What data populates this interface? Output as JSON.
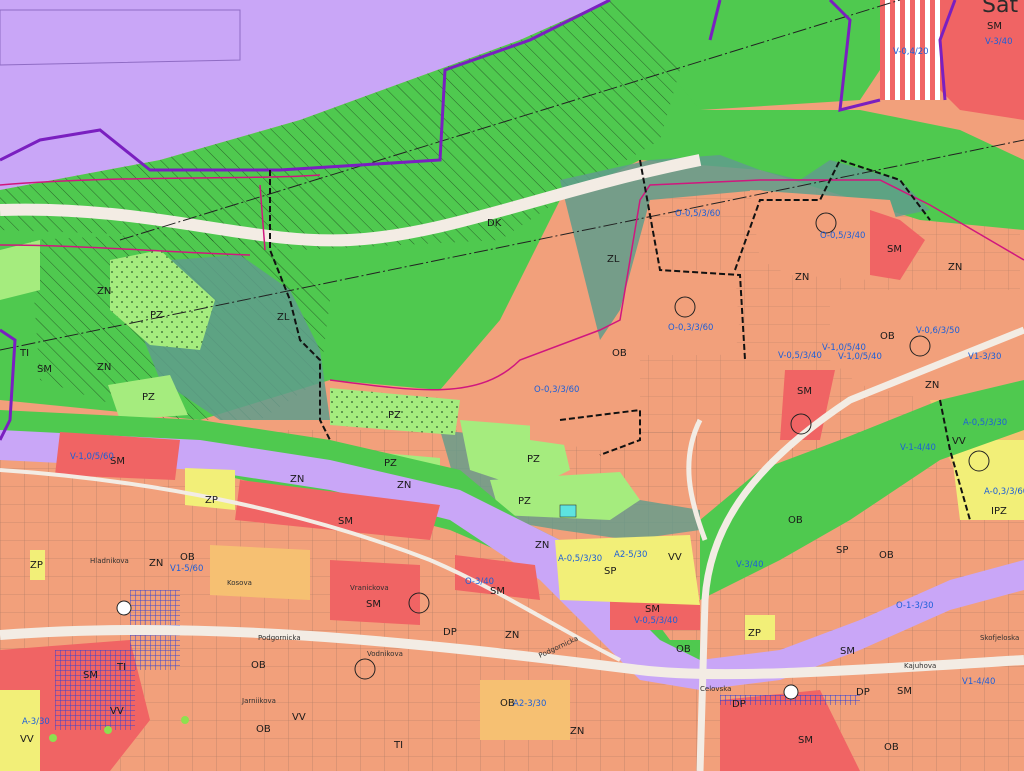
{
  "map": {
    "top_right_label": "Sat",
    "colors": {
      "residential_mixed_OB": "#f2a07b",
      "mixed_center_SM": "#f06464",
      "green_ZN_ZL": "#4fc94f",
      "garden_PZ": "#a5ec7e",
      "special_ZP": "#f6c072",
      "sport_SP": "#f2ef78",
      "transport_DP": "#c9a6f7",
      "water": "#5de3e0",
      "regional_boundary": "#7a1fc0",
      "route_pink": "#d0177e",
      "annotation_blue": "#1d5fd8"
    },
    "zone_labels": [
      {
        "id": "dk",
        "text": "DK"
      },
      {
        "id": "zl1",
        "text": "ZL"
      },
      {
        "id": "zl2",
        "text": "ZL"
      },
      {
        "id": "zn1",
        "text": "ZN"
      },
      {
        "id": "zn2",
        "text": "ZN"
      },
      {
        "id": "zn3",
        "text": "ZN"
      },
      {
        "id": "zn4",
        "text": "ZN"
      },
      {
        "id": "zn5",
        "text": "ZN"
      },
      {
        "id": "zn6",
        "text": "ZN"
      },
      {
        "id": "zn7",
        "text": "ZN"
      },
      {
        "id": "zn8",
        "text": "ZN"
      },
      {
        "id": "zn9",
        "text": "ZN"
      },
      {
        "id": "zn10",
        "text": "ZN"
      },
      {
        "id": "pz1",
        "text": "PZ"
      },
      {
        "id": "pz2",
        "text": "PZ"
      },
      {
        "id": "pz3",
        "text": "PZ"
      },
      {
        "id": "pz4",
        "text": "PZ"
      },
      {
        "id": "pz5",
        "text": "PZ"
      },
      {
        "id": "pz6",
        "text": "PZ"
      },
      {
        "id": "sm1",
        "text": "SM"
      },
      {
        "id": "sm2",
        "text": "SM"
      },
      {
        "id": "sm3",
        "text": "SM"
      },
      {
        "id": "sm4",
        "text": "SM"
      },
      {
        "id": "sm5",
        "text": "SM"
      },
      {
        "id": "sm6",
        "text": "SM"
      },
      {
        "id": "sm7",
        "text": "SM"
      },
      {
        "id": "sm8",
        "text": "SM"
      },
      {
        "id": "sm9",
        "text": "SM"
      },
      {
        "id": "sm10",
        "text": "SM"
      },
      {
        "id": "sm11",
        "text": "SM"
      },
      {
        "id": "sm12",
        "text": "SM"
      },
      {
        "id": "sm13",
        "text": "SM"
      },
      {
        "id": "ob1",
        "text": "OB"
      },
      {
        "id": "ob2",
        "text": "OB"
      },
      {
        "id": "ob3",
        "text": "OB"
      },
      {
        "id": "ob4",
        "text": "OB"
      },
      {
        "id": "ob5",
        "text": "OB"
      },
      {
        "id": "ob6",
        "text": "OB"
      },
      {
        "id": "ob7",
        "text": "OB"
      },
      {
        "id": "ob8",
        "text": "OB"
      },
      {
        "id": "ob9",
        "text": "OB"
      },
      {
        "id": "ob10",
        "text": "OB"
      },
      {
        "id": "sp1",
        "text": "SP"
      },
      {
        "id": "sp2",
        "text": "SP"
      },
      {
        "id": "dp1",
        "text": "DP"
      },
      {
        "id": "dp2",
        "text": "DP"
      },
      {
        "id": "dp3",
        "text": "DP"
      },
      {
        "id": "vv1",
        "text": "VV"
      },
      {
        "id": "vv2",
        "text": "VV"
      },
      {
        "id": "vv3",
        "text": "VV"
      },
      {
        "id": "vv4",
        "text": "VV"
      },
      {
        "id": "vv5",
        "text": "VV"
      },
      {
        "id": "ti1",
        "text": "TI"
      },
      {
        "id": "ti2",
        "text": "TI"
      },
      {
        "id": "ti3",
        "text": "TI"
      },
      {
        "id": "zp_sq1",
        "text": "ZP"
      },
      {
        "id": "zp_sq2",
        "text": "ZP"
      },
      {
        "id": "zp_sq3",
        "text": "ZP"
      },
      {
        "id": "zn_sq",
        "text": "ZN"
      },
      {
        "id": "ipz",
        "text": "IPZ"
      },
      {
        "id": "m1",
        "text": "M"
      },
      {
        "id": "m2",
        "text": "M"
      }
    ],
    "code_labels": [
      {
        "id": "c1",
        "text": "O-0,5/3/60"
      },
      {
        "id": "c2",
        "text": "O-0,5/3/40"
      },
      {
        "id": "c3",
        "text": "O-0,3/3/60"
      },
      {
        "id": "c4",
        "text": "V-0,5/3/40"
      },
      {
        "id": "c5",
        "text": "V-1,0/5/40"
      },
      {
        "id": "c6",
        "text": "V-1,0/5/40"
      },
      {
        "id": "c7",
        "text": "V-0,6/3/50"
      },
      {
        "id": "c8",
        "text": "V1-3/30"
      },
      {
        "id": "c9",
        "text": "O-0,3/3/60"
      },
      {
        "id": "c10",
        "text": "V-1,0/5/60"
      },
      {
        "id": "c11",
        "text": "V1-5/60"
      },
      {
        "id": "c12",
        "text": "A-0,5/3/30"
      },
      {
        "id": "c13",
        "text": "A-0,3/3/60"
      },
      {
        "id": "c14",
        "text": "A2-5/30"
      },
      {
        "id": "c15",
        "text": "A-0,5/3/30"
      },
      {
        "id": "c16",
        "text": "V-0,5/3/40"
      },
      {
        "id": "c17",
        "text": "V-1-4/40"
      },
      {
        "id": "c18",
        "text": "V-0,4/20"
      },
      {
        "id": "c19",
        "text": "V-3/40"
      },
      {
        "id": "c20",
        "text": "O-1-3/30"
      },
      {
        "id": "c21",
        "text": "A-3/30"
      },
      {
        "id": "c22",
        "text": "A2-3/30"
      },
      {
        "id": "c23",
        "text": "V-3/40"
      },
      {
        "id": "c24",
        "text": "V1-4/40"
      },
      {
        "id": "c25",
        "text": "O-3/40"
      }
    ],
    "street_labels": [
      {
        "id": "s1",
        "text": "Podgornicka"
      },
      {
        "id": "s2",
        "text": "Podgornicka"
      },
      {
        "id": "s3",
        "text": "Vodnikova"
      },
      {
        "id": "s4",
        "text": "Hladnikova"
      },
      {
        "id": "s5",
        "text": "Kajuhova"
      },
      {
        "id": "s6",
        "text": "Skofjeloska"
      },
      {
        "id": "s7",
        "text": "Jarniikova"
      },
      {
        "id": "s8",
        "text": "Celovska"
      },
      {
        "id": "s9",
        "text": "Kosova"
      },
      {
        "id": "s10",
        "text": "Vranickova"
      }
    ]
  }
}
